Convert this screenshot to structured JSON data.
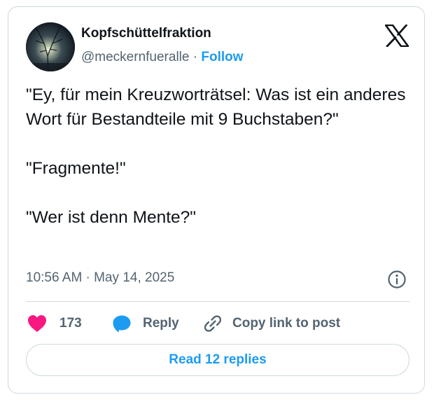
{
  "author": {
    "display_name": "Kopfschüttelfraktion",
    "handle": "@meckernfueralle",
    "separator": "·",
    "follow_label": "Follow",
    "avatar_icon": "profile-photo"
  },
  "brand": {
    "logo_icon": "x-logo-icon"
  },
  "tweet": {
    "lines": [
      "\"Ey, für mein Kreuzworträtsel: Was ist ein anderes Wort für Bestandteile mit 9 Buchstaben?\"",
      "\"Fragmente!\"",
      "\"Wer ist denn Mente?\""
    ],
    "time": "10:56 AM · May 14, 2025"
  },
  "actions": {
    "like_count": "173",
    "reply_label": "Reply",
    "copy_label": "Copy link to post",
    "read_replies_label": "Read 12 replies"
  },
  "colors": {
    "accent": "#1d9bf0",
    "like": "#f91880",
    "text": "#0f1419",
    "secondary": "#536471",
    "border": "#cfd9de"
  }
}
